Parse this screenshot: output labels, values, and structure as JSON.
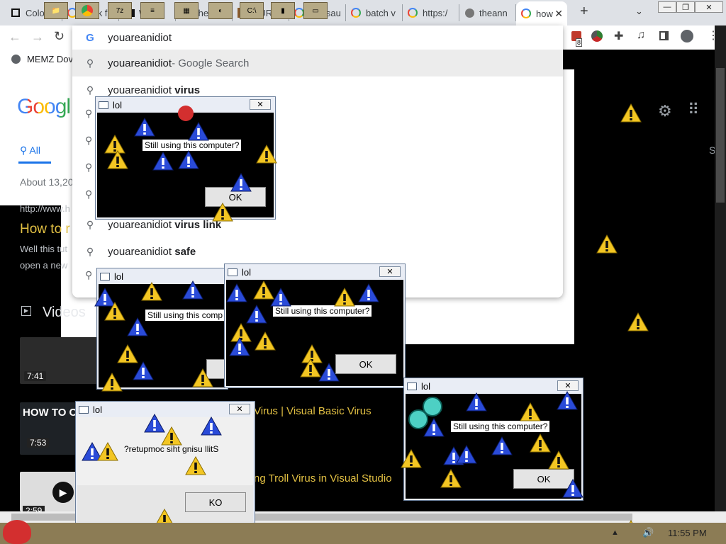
{
  "browser": {
    "tabs": [
      {
        "label": "Color F",
        "icon": "tab-favicon"
      },
      {
        "label": "dank fu",
        "icon": "google-favicon"
      },
      {
        "label": "Watch",
        "icon": "tv-favicon"
      },
      {
        "label": "the fuc",
        "icon": "google-favicon"
      },
      {
        "label": "HURR-",
        "icon": "image-favicon"
      },
      {
        "label": "vinesau",
        "icon": "google-favicon"
      },
      {
        "label": "batch v",
        "icon": "google-favicon"
      },
      {
        "label": "https:/",
        "icon": "google-favicon"
      },
      {
        "label": "theann",
        "icon": "globe-favicon"
      },
      {
        "label": "how",
        "icon": "google-favicon",
        "active": true
      }
    ],
    "new_tab": "+",
    "omnibox": {
      "value": "youareanidiot"
    },
    "bookmark": "MEMZ Dov",
    "extension_badge": "8"
  },
  "suggestions": [
    {
      "main": "youareanidiot",
      "bold": "",
      "suffix": " - Google Search"
    },
    {
      "main": "youareanidiot ",
      "bold": "virus",
      "suffix": ""
    },
    {
      "main": "youareanidiot ",
      "bold": "virus link",
      "suffix": ""
    },
    {
      "main": "youareanidiot ",
      "bold": "safe",
      "suffix": ""
    }
  ],
  "page": {
    "logo": "Googl",
    "tab_all": "All",
    "about": "About 13,20",
    "url_snippet": "http://www.h",
    "result_title": "How to r",
    "snippet1": "Well this tut",
    "snippet2": "open a new",
    "videos_heading": "Videos",
    "video_durations": [
      "7:41",
      "7:53",
      "2:59"
    ],
    "video_title_1": "Virus | Visual Basic Virus",
    "video_title_2": "ng Troll Virus in Visual Studio",
    "thumb_text": "HOW TO C",
    "side_letter": "S"
  },
  "dialogs": {
    "title": "lol",
    "close": "⊠",
    "message": "Still using this computer?",
    "message_partial": "Still using this comp",
    "message_reversed": "?retupmoc siht gnisu llitS",
    "ok": "OK",
    "ok_reversed": "KO"
  },
  "taskbar": {
    "clock": "11:55 PM",
    "apps": [
      "chrome",
      "7z",
      "notepad",
      "calc",
      "paint",
      "cmd",
      "files",
      "screen"
    ]
  }
}
